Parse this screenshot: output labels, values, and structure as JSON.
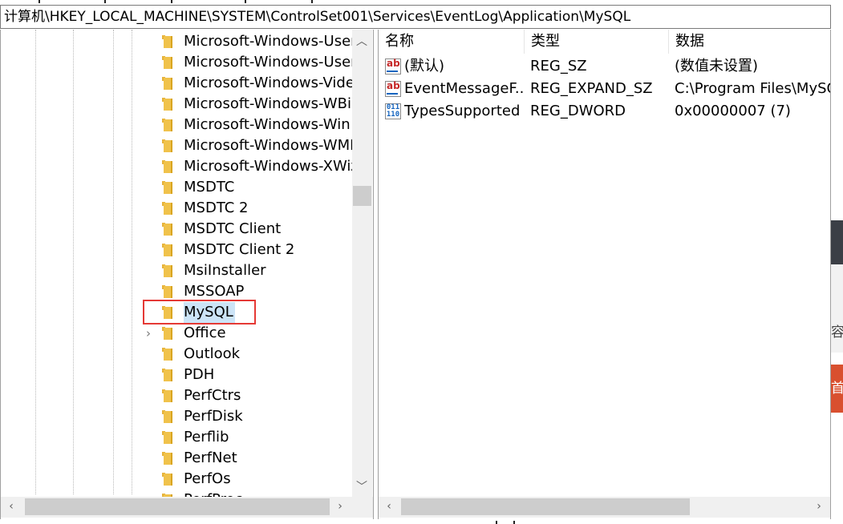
{
  "address_bar": {
    "path": "计算机\\HKEY_LOCAL_MACHINE\\SYSTEM\\ControlSet001\\Services\\EventLog\\Application\\MySQL"
  },
  "tree": {
    "items": [
      {
        "label": "Microsoft-Windows-User",
        "has_children": false,
        "selected": false
      },
      {
        "label": "Microsoft-Windows-User",
        "has_children": false,
        "selected": false
      },
      {
        "label": "Microsoft-Windows-Video",
        "has_children": false,
        "selected": false
      },
      {
        "label": "Microsoft-Windows-WBiometric",
        "has_children": false,
        "selected": false
      },
      {
        "label": "Microsoft-Windows-Win",
        "has_children": false,
        "selected": false
      },
      {
        "label": "Microsoft-Windows-WMI",
        "has_children": false,
        "selected": false
      },
      {
        "label": "Microsoft-Windows-XWizard",
        "has_children": false,
        "selected": false
      },
      {
        "label": "MSDTC",
        "has_children": false,
        "selected": false
      },
      {
        "label": "MSDTC 2",
        "has_children": false,
        "selected": false
      },
      {
        "label": "MSDTC Client",
        "has_children": false,
        "selected": false
      },
      {
        "label": "MSDTC Client 2",
        "has_children": false,
        "selected": false
      },
      {
        "label": "MsiInstaller",
        "has_children": false,
        "selected": false
      },
      {
        "label": "MSSOAP",
        "has_children": false,
        "selected": false
      },
      {
        "label": "MySQL",
        "has_children": false,
        "selected": true
      },
      {
        "label": "Office",
        "has_children": true,
        "selected": false
      },
      {
        "label": "Outlook",
        "has_children": false,
        "selected": false
      },
      {
        "label": "PDH",
        "has_children": false,
        "selected": false
      },
      {
        "label": "PerfCtrs",
        "has_children": false,
        "selected": false
      },
      {
        "label": "PerfDisk",
        "has_children": false,
        "selected": false
      },
      {
        "label": "Perflib",
        "has_children": false,
        "selected": false
      },
      {
        "label": "PerfNet",
        "has_children": false,
        "selected": false
      },
      {
        "label": "PerfOs",
        "has_children": false,
        "selected": false
      },
      {
        "label": "PerfProc",
        "has_children": false,
        "selected": false
      }
    ]
  },
  "values": {
    "columns": {
      "name": "名称",
      "type": "类型",
      "data": "数据"
    },
    "rows": [
      {
        "icon": "string-value-icon",
        "name": "(默认)",
        "type": "REG_SZ",
        "data": "(数值未设置)"
      },
      {
        "icon": "string-value-icon",
        "name": "EventMessageF...",
        "type": "REG_EXPAND_SZ",
        "data": "C:\\Program Files\\MySQL"
      },
      {
        "icon": "binary-value-icon",
        "name": "TypesSupported",
        "type": "REG_DWORD",
        "data": "0x00000007 (7)"
      }
    ]
  },
  "desktop": {
    "edge_char_1": "容",
    "edge_char_2": "首"
  },
  "colors": {
    "selection": "#cce4f7",
    "highlight_box": "#e53935",
    "folder": "#f0c24b"
  }
}
